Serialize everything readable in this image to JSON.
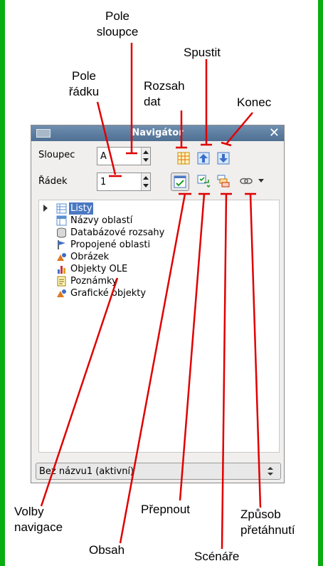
{
  "window": {
    "title": "Navigátor",
    "column_label": "Sloupec",
    "column_value": "A",
    "row_label": "Řádek",
    "row_value": "1",
    "document_selector": "Bez názvu1 (aktivní)"
  },
  "tree": [
    {
      "label": "Listy",
      "icon": "sheets-icon",
      "selected": true
    },
    {
      "label": "Názvy oblastí",
      "icon": "range-names-icon"
    },
    {
      "label": "Databázové rozsahy",
      "icon": "database-ranges-icon"
    },
    {
      "label": "Propojené oblasti",
      "icon": "linked-areas-icon"
    },
    {
      "label": "Obrázek",
      "icon": "image-icon"
    },
    {
      "label": "Objekty OLE",
      "icon": "ole-objects-icon"
    },
    {
      "label": "Poznámky",
      "icon": "notes-icon"
    },
    {
      "label": "Grafické objekty",
      "icon": "drawing-objects-icon"
    }
  ],
  "callouts": {
    "column_field": "Pole sloupce",
    "start": "Spustit",
    "row_field": "Pole řádku",
    "data_range": "Rozsah dat",
    "end": "Konec",
    "navigation_options": "Volby navigace",
    "toggle": "Přepnout",
    "drag_mode": "Způsob přetáhnutí",
    "content": "Obsah",
    "scenarios": "Scénáře"
  },
  "colors": {
    "frame": "#0aad10",
    "titlebar": "#5a7a9e",
    "selection": "#4a78c2",
    "callout_line": "#e00000"
  }
}
